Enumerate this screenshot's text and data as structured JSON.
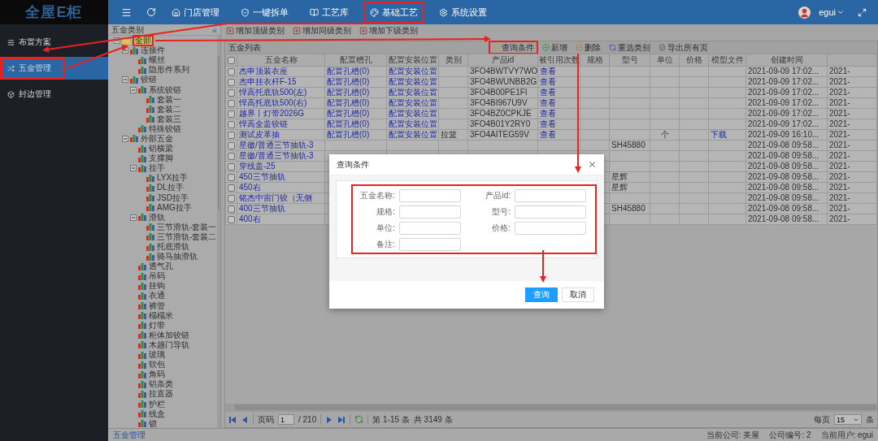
{
  "logo": "全屋E柜",
  "nav": [
    {
      "label": "门店管理",
      "annotated": false
    },
    {
      "label": "一键拆单",
      "annotated": false
    },
    {
      "label": "工艺库",
      "annotated": false
    },
    {
      "label": "基础工艺",
      "annotated": true
    },
    {
      "label": "系统设置",
      "annotated": false
    }
  ],
  "user": {
    "name": "egui"
  },
  "sidebar": [
    {
      "label": "布置方案",
      "selected": false,
      "annotated": false
    },
    {
      "label": "五金管理",
      "selected": true,
      "annotated": true
    },
    {
      "label": "封边管理",
      "selected": false,
      "annotated": false
    }
  ],
  "tree": {
    "title": "五金类别",
    "collapse": "«",
    "nodes": [
      {
        "label": "全部",
        "selected": true,
        "annotated": true,
        "expanded": true,
        "children": [
          {
            "label": "连接件",
            "selected": false,
            "expanded": true,
            "children": [
              {
                "label": "螺丝",
                "selected": false
              },
              {
                "label": "隐形件系列",
                "selected": false
              }
            ]
          },
          {
            "label": "铰链",
            "selected": false,
            "expanded": true,
            "children": [
              {
                "label": "系统铰链",
                "selected": false,
                "expanded": true,
                "children": [
                  {
                    "label": "套装一",
                    "selected": false
                  },
                  {
                    "label": "套装二",
                    "selected": false
                  },
                  {
                    "label": "套装三",
                    "selected": false
                  }
                ]
              },
              {
                "label": "特殊铰链",
                "selected": false
              }
            ]
          },
          {
            "label": "外部五金",
            "selected": false,
            "expanded": true,
            "children": [
              {
                "label": "铝横梁",
                "selected": false
              },
              {
                "label": "支撑脚",
                "selected": false
              },
              {
                "label": "拉手",
                "selected": false,
                "expanded": true,
                "children": [
                  {
                    "label": "LYX拉手",
                    "selected": false
                  },
                  {
                    "label": "DL拉手",
                    "selected": false
                  },
                  {
                    "label": "JSD拉手",
                    "selected": false
                  },
                  {
                    "label": "AMG拉手",
                    "selected": false
                  }
                ]
              },
              {
                "label": "滑轨",
                "selected": false,
                "expanded": true,
                "children": [
                  {
                    "label": "三节滑轨-套装一",
                    "selected": false
                  },
                  {
                    "label": "三节滑轨-套装二",
                    "selected": false
                  },
                  {
                    "label": "托底滑轨",
                    "selected": false
                  },
                  {
                    "label": "骑马抽滑轨",
                    "selected": false
                  }
                ]
              },
              {
                "label": "透气孔",
                "selected": false
              },
              {
                "label": "吊码",
                "selected": false
              },
              {
                "label": "挂钩",
                "selected": false
              },
              {
                "label": "衣通",
                "selected": false
              },
              {
                "label": "裤管",
                "selected": false
              },
              {
                "label": "榻榻米",
                "selected": false
              },
              {
                "label": "灯带",
                "selected": false
              },
              {
                "label": "柜体加铰链",
                "selected": false
              },
              {
                "label": "木趟门导轨",
                "selected": false
              },
              {
                "label": "玻璃",
                "selected": false
              },
              {
                "label": "软包",
                "selected": false
              },
              {
                "label": "角码",
                "selected": false
              },
              {
                "label": "铝条类",
                "selected": false
              },
              {
                "label": "拉直器",
                "selected": false
              },
              {
                "label": "护栏",
                "selected": false
              },
              {
                "label": "线盒",
                "selected": false
              },
              {
                "label": "锁",
                "selected": false
              }
            ]
          }
        ]
      }
    ]
  },
  "toolbar": [
    "增加顶级类别",
    "增加同级类别",
    "增加下级类别"
  ],
  "grid": {
    "title": "五金列表",
    "actions": [
      {
        "label": "查询条件",
        "annotated": true
      },
      {
        "label": "新增",
        "annotated": false
      },
      {
        "label": "删除",
        "annotated": false
      },
      {
        "label": "重选类别",
        "annotated": false
      },
      {
        "label": "导出所有页",
        "annotated": false
      }
    ],
    "all_checked": false,
    "columns": [
      "五金名称",
      "配置槽孔",
      "配置安装位置",
      "类别",
      "产品id",
      "被引用次数",
      "规格",
      "型号",
      "单位",
      "价格",
      "模型文件",
      "创建时间"
    ],
    "rows": [
      {
        "checked": false,
        "name": "杰申顶装衣座",
        "slot": "配置孔槽(0)",
        "position": "配置安装位置",
        "product_id": "3FO4BWTVY7WO",
        "refs": "查看",
        "created": "2021-09-09 17:02...",
        "column_14": "2021-"
      },
      {
        "checked": false,
        "name": "杰申挂衣杆F-15",
        "slot": "配置孔槽(0)",
        "position": "配置安装位置",
        "product_id": "3FO4BWUNBB2G",
        "refs": "查看",
        "created": "2021-09-09 17:02...",
        "column_14": "2021-"
      },
      {
        "checked": false,
        "name": "悍高托底轨500(左)",
        "slot": "配置孔槽(0)",
        "position": "配置安装位置",
        "product_id": "3FO4B00PE1FI",
        "refs": "查看",
        "created": "2021-09-09 17:02...",
        "column_14": "2021-"
      },
      {
        "checked": false,
        "name": "悍高托底轨500(右)",
        "slot": "配置孔槽(0)",
        "position": "配置安装位置",
        "product_id": "3FO4BI967U9V",
        "refs": "查看",
        "created": "2021-09-09 17:02...",
        "column_14": "2021-"
      },
      {
        "checked": false,
        "name": "越界丨灯带2026G",
        "slot": "配置孔槽(0)",
        "position": "配置安装位置",
        "product_id": "3FO4BZ0CPKJE",
        "refs": "查看",
        "created": "2021-09-09 17:02...",
        "column_14": "2021-"
      },
      {
        "checked": false,
        "name": "悍高全盖铰链",
        "slot": "配置孔槽(0)",
        "position": "配置安装位置",
        "product_id": "3FO4B01Y2RY0",
        "refs": "查看",
        "created": "2021-09-09 17:02...",
        "column_14": "2021-"
      },
      {
        "checked": false,
        "name": "测试皮革抽",
        "slot": "配置孔槽(0)",
        "position": "配置安装位置",
        "category": "拉篮",
        "product_id": "3FO4AITEG59V",
        "refs": "查看",
        "unit": "个",
        "file": "下载",
        "created": "2021-09-09 16:10...",
        "column_14": "2021-"
      },
      {
        "checked": false,
        "name": "星徽/普通三节抽轨-3",
        "model": "SH45880",
        "created": "2021-09-08 09:58...",
        "column_14": "2021-"
      },
      {
        "checked": false,
        "name": "星徽/普通三节抽轨-3",
        "created": "2021-09-08 09:58...",
        "column_14": "2021-"
      },
      {
        "checked": false,
        "name": "穿线盖-25",
        "created": "2021-09-08 09:58...",
        "column_14": "2021-"
      },
      {
        "checked": false,
        "name": "450三节抽轨",
        "model": "星辉",
        "created": "2021-09-08 09:58...",
        "column_14": "2021-"
      },
      {
        "checked": false,
        "name": "450右",
        "model": "星辉",
        "created": "2021-09-08 09:58...",
        "column_14": "2021-"
      },
      {
        "checked": false,
        "name": "铭杰中宙门铰（无侧",
        "created": "2021-09-08 09:58...",
        "column_14": "2021-"
      },
      {
        "checked": false,
        "name": "400三节抽轨",
        "model": "SH45880",
        "created": "2021-09-08 09:58...",
        "column_14": "2021-"
      },
      {
        "checked": false,
        "name": "400右",
        "created": "2021-09-08 09:58...",
        "column_14": "2021-"
      }
    ]
  },
  "pager": {
    "page_label": "页码",
    "page": "1",
    "total_pages": "/ 210",
    "range": "第 1-15 条",
    "total": "共 3149 条",
    "per_page_label": "每页",
    "per_page": "15",
    "per_page_unit": "条"
  },
  "status": {
    "module": "五金管理",
    "company": "当前公司: 美屋",
    "company_no": "公司编号: 2",
    "user": "当前用户: egui"
  },
  "modal": {
    "title": "查询条件",
    "annotated": true,
    "fields": [
      {
        "label": "五金名称:"
      },
      {
        "label": "产品id:"
      },
      {
        "label": "规格:"
      },
      {
        "label": "型号:"
      },
      {
        "label": "单位:"
      },
      {
        "label": "价格:"
      },
      {
        "label": "备注:"
      }
    ],
    "buttons": [
      {
        "label": "查询",
        "kind": "primary"
      },
      {
        "label": "取消",
        "kind": "default"
      }
    ]
  }
}
